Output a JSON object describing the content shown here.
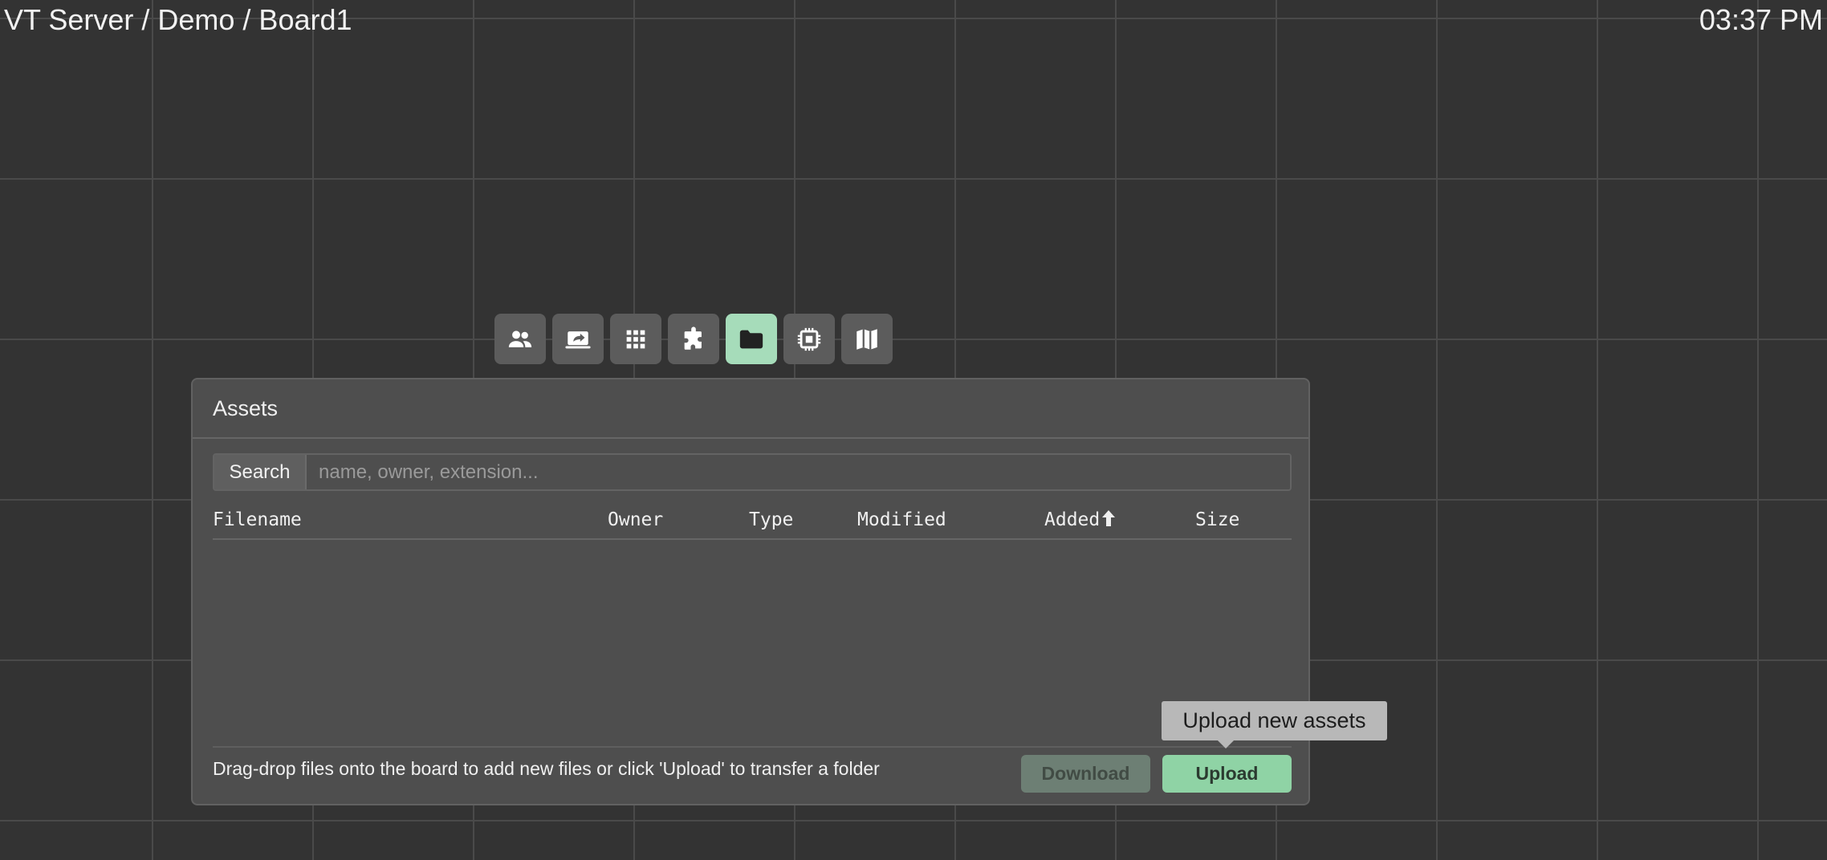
{
  "header": {
    "breadcrumb": "VT Server / Demo / Board1",
    "clock": "03:37 PM"
  },
  "toolbar": {
    "buttons": [
      {
        "icon": "users-icon",
        "active": false
      },
      {
        "icon": "screenshare-icon",
        "active": false
      },
      {
        "icon": "apps-grid-icon",
        "active": false
      },
      {
        "icon": "puzzle-icon",
        "active": false
      },
      {
        "icon": "folder-icon",
        "active": true
      },
      {
        "icon": "chip-icon",
        "active": false
      },
      {
        "icon": "map-icon",
        "active": false
      }
    ],
    "active_color": "#a6dcba"
  },
  "assets_panel": {
    "title": "Assets",
    "search": {
      "label": "Search",
      "placeholder": "name, owner, extension...",
      "value": ""
    },
    "columns": {
      "filename": "Filename",
      "owner": "Owner",
      "type": "Type",
      "modified": "Modified",
      "added": "Added",
      "size": "Size"
    },
    "sort_column": "added",
    "sort_direction": "ascending",
    "rows": [],
    "footer_hint": "Drag-drop files onto the board to add new files or click 'Upload' to transfer a folder",
    "download_label": "Download",
    "upload_label": "Upload",
    "upload_tooltip": "Upload new assets",
    "upload_color": "#8fd3a5"
  }
}
